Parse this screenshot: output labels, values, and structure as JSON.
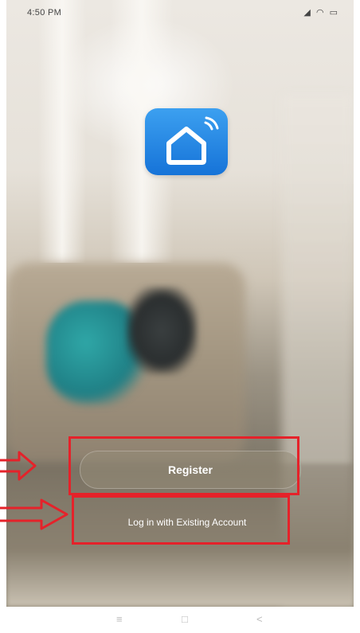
{
  "status_bar": {
    "time": "4:50 PM",
    "icons": "◢ ◠ ▭"
  },
  "app_icon": {
    "name": "home-wifi-icon",
    "color_top": "#3ca0f0",
    "color_bottom": "#1673d8"
  },
  "buttons": {
    "register": "Register",
    "login": "Log in with Existing Account"
  },
  "annotation_color": "#e5222a",
  "nav_bar": {
    "menu": "≡",
    "home": "□",
    "back": "<"
  }
}
